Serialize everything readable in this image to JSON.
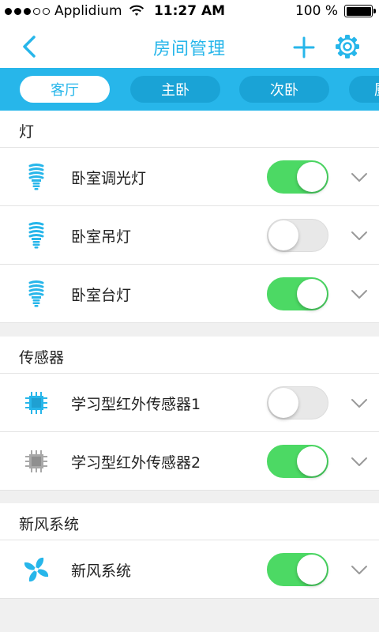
{
  "status_bar": {
    "carrier": "Applidium",
    "time": "11:27 AM",
    "battery_text": "100 %"
  },
  "nav": {
    "title": "房间管理"
  },
  "tabs": [
    {
      "label": "客厅",
      "active": true
    },
    {
      "label": "主卧",
      "active": false
    },
    {
      "label": "次卧",
      "active": false
    },
    {
      "label": "厨",
      "active": false
    }
  ],
  "sections": [
    {
      "title": "灯",
      "rows": [
        {
          "label": "卧室调光灯",
          "icon": "bulb-icon",
          "on": true
        },
        {
          "label": "卧室吊灯",
          "icon": "bulb-icon",
          "on": false
        },
        {
          "label": "卧室台灯",
          "icon": "bulb-icon",
          "on": true
        }
      ]
    },
    {
      "title": "传感器",
      "rows": [
        {
          "label": "学习型红外传感器1",
          "icon": "chip-icon",
          "on": false
        },
        {
          "label": "学习型红外传感器2",
          "icon": "chip-icon",
          "on": true
        }
      ]
    },
    {
      "title": "新风系统",
      "rows": [
        {
          "label": "新风系统",
          "icon": "fan-icon",
          "on": true
        }
      ]
    }
  ],
  "colors": {
    "accent": "#27b6ea",
    "tab_pill": "#1aa3d6",
    "switch_on": "#4cd964",
    "chip_gray": "#a8a8a8"
  }
}
